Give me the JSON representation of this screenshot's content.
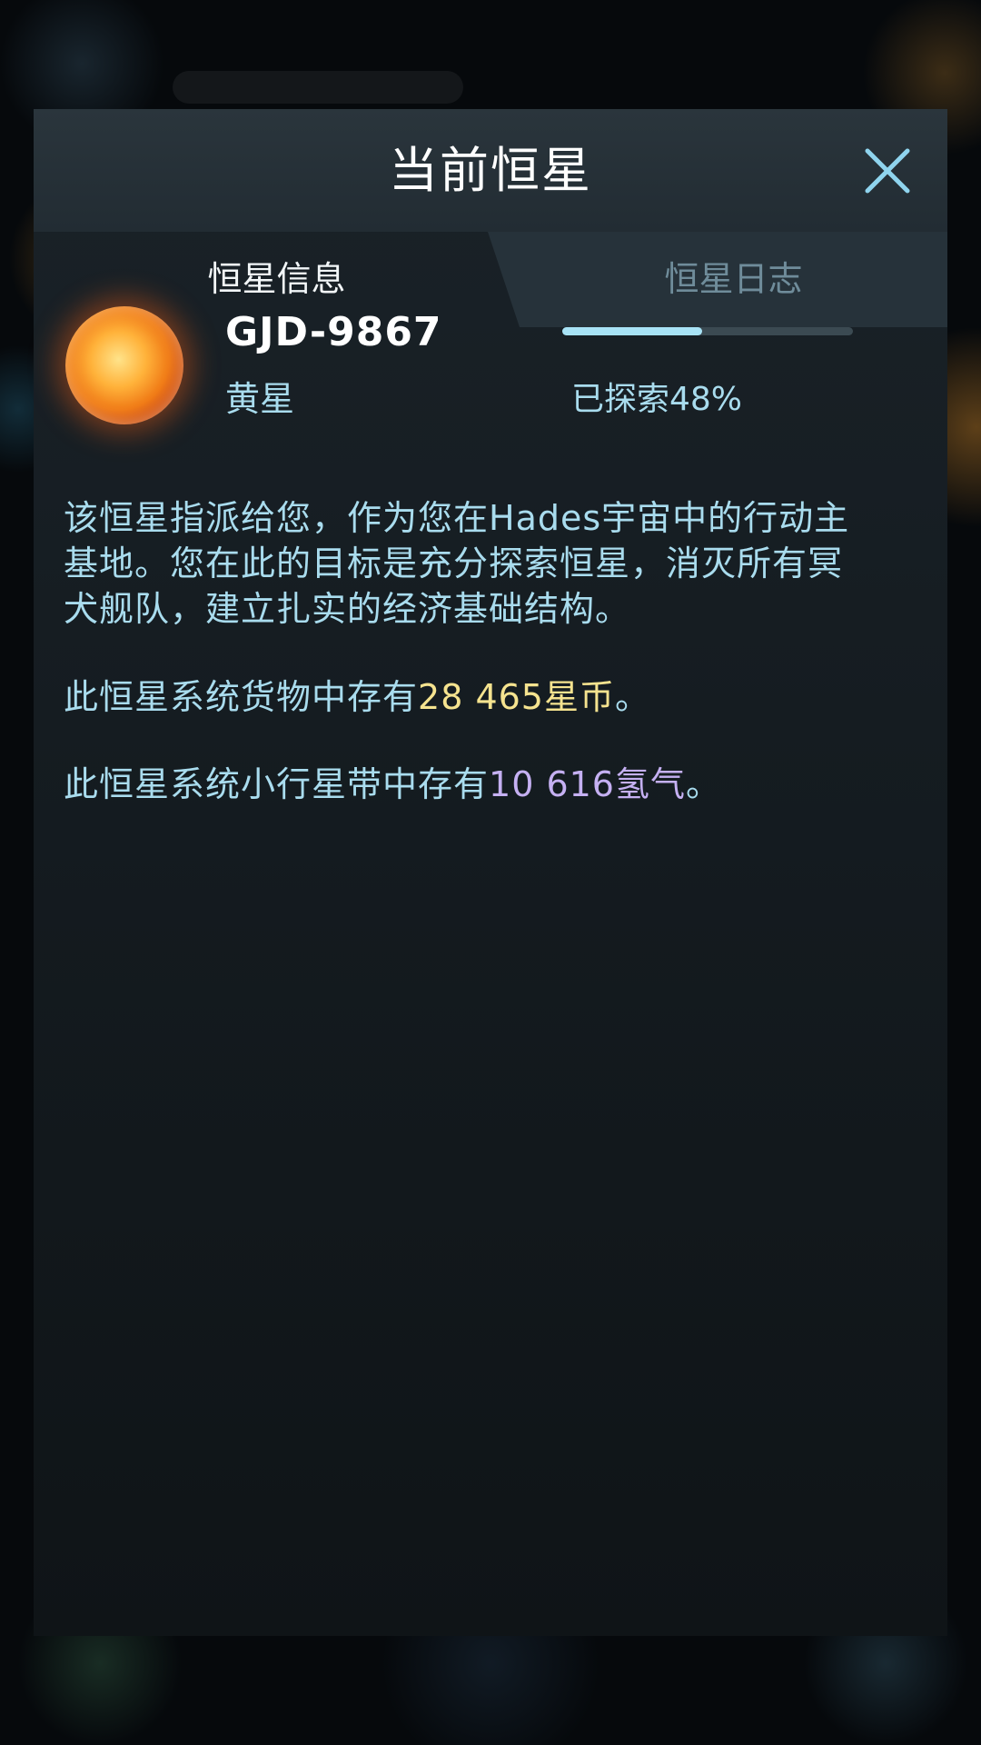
{
  "dialog": {
    "title": "当前恒星",
    "close_icon": "close-icon"
  },
  "tabs": [
    {
      "label": "恒星信息",
      "active": true
    },
    {
      "label": "恒星日志",
      "active": false
    }
  ],
  "star": {
    "name": "GJD-9867",
    "type": "黄星",
    "explored_text": "已探索48%",
    "explored_fraction": 0.48,
    "icon": "sun-icon"
  },
  "info": {
    "description": "该恒星指派给您，作为您在Hades宇宙中的行动主基地。您在此的目标是充分探索恒星，消灭所有冥犬舰队，建立扎实的经济基础结构。",
    "cargo_prefix": "此恒星系统货物中存有",
    "cargo_amount": "28 465星币",
    "cargo_suffix": "。",
    "asteroid_prefix": "此恒星系统小行星带中存有",
    "asteroid_amount": "10 616氢气",
    "asteroid_suffix": "。"
  },
  "colors": {
    "accent_text": "#a9dcee",
    "credits": "#f5e38f",
    "hydrogen": "#c5b0f2",
    "progress_fill": "#a8e3f6"
  }
}
